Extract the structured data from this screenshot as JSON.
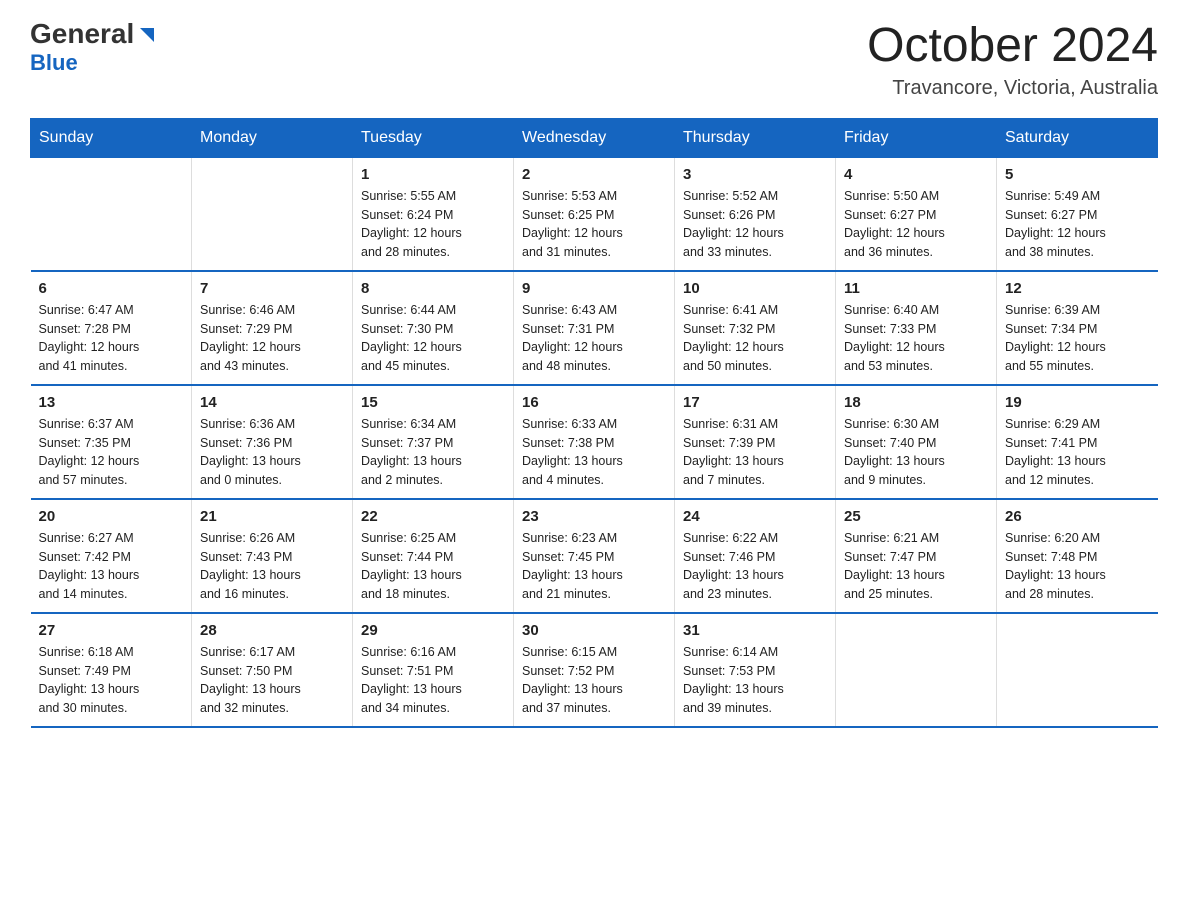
{
  "header": {
    "logo": {
      "general": "General",
      "blue": "Blue"
    },
    "title": "October 2024",
    "location": "Travancore, Victoria, Australia"
  },
  "weekdays": [
    "Sunday",
    "Monday",
    "Tuesday",
    "Wednesday",
    "Thursday",
    "Friday",
    "Saturday"
  ],
  "weeks": [
    [
      {
        "day": "",
        "info": ""
      },
      {
        "day": "",
        "info": ""
      },
      {
        "day": "1",
        "info": "Sunrise: 5:55 AM\nSunset: 6:24 PM\nDaylight: 12 hours\nand 28 minutes."
      },
      {
        "day": "2",
        "info": "Sunrise: 5:53 AM\nSunset: 6:25 PM\nDaylight: 12 hours\nand 31 minutes."
      },
      {
        "day": "3",
        "info": "Sunrise: 5:52 AM\nSunset: 6:26 PM\nDaylight: 12 hours\nand 33 minutes."
      },
      {
        "day": "4",
        "info": "Sunrise: 5:50 AM\nSunset: 6:27 PM\nDaylight: 12 hours\nand 36 minutes."
      },
      {
        "day": "5",
        "info": "Sunrise: 5:49 AM\nSunset: 6:27 PM\nDaylight: 12 hours\nand 38 minutes."
      }
    ],
    [
      {
        "day": "6",
        "info": "Sunrise: 6:47 AM\nSunset: 7:28 PM\nDaylight: 12 hours\nand 41 minutes."
      },
      {
        "day": "7",
        "info": "Sunrise: 6:46 AM\nSunset: 7:29 PM\nDaylight: 12 hours\nand 43 minutes."
      },
      {
        "day": "8",
        "info": "Sunrise: 6:44 AM\nSunset: 7:30 PM\nDaylight: 12 hours\nand 45 minutes."
      },
      {
        "day": "9",
        "info": "Sunrise: 6:43 AM\nSunset: 7:31 PM\nDaylight: 12 hours\nand 48 minutes."
      },
      {
        "day": "10",
        "info": "Sunrise: 6:41 AM\nSunset: 7:32 PM\nDaylight: 12 hours\nand 50 minutes."
      },
      {
        "day": "11",
        "info": "Sunrise: 6:40 AM\nSunset: 7:33 PM\nDaylight: 12 hours\nand 53 minutes."
      },
      {
        "day": "12",
        "info": "Sunrise: 6:39 AM\nSunset: 7:34 PM\nDaylight: 12 hours\nand 55 minutes."
      }
    ],
    [
      {
        "day": "13",
        "info": "Sunrise: 6:37 AM\nSunset: 7:35 PM\nDaylight: 12 hours\nand 57 minutes."
      },
      {
        "day": "14",
        "info": "Sunrise: 6:36 AM\nSunset: 7:36 PM\nDaylight: 13 hours\nand 0 minutes."
      },
      {
        "day": "15",
        "info": "Sunrise: 6:34 AM\nSunset: 7:37 PM\nDaylight: 13 hours\nand 2 minutes."
      },
      {
        "day": "16",
        "info": "Sunrise: 6:33 AM\nSunset: 7:38 PM\nDaylight: 13 hours\nand 4 minutes."
      },
      {
        "day": "17",
        "info": "Sunrise: 6:31 AM\nSunset: 7:39 PM\nDaylight: 13 hours\nand 7 minutes."
      },
      {
        "day": "18",
        "info": "Sunrise: 6:30 AM\nSunset: 7:40 PM\nDaylight: 13 hours\nand 9 minutes."
      },
      {
        "day": "19",
        "info": "Sunrise: 6:29 AM\nSunset: 7:41 PM\nDaylight: 13 hours\nand 12 minutes."
      }
    ],
    [
      {
        "day": "20",
        "info": "Sunrise: 6:27 AM\nSunset: 7:42 PM\nDaylight: 13 hours\nand 14 minutes."
      },
      {
        "day": "21",
        "info": "Sunrise: 6:26 AM\nSunset: 7:43 PM\nDaylight: 13 hours\nand 16 minutes."
      },
      {
        "day": "22",
        "info": "Sunrise: 6:25 AM\nSunset: 7:44 PM\nDaylight: 13 hours\nand 18 minutes."
      },
      {
        "day": "23",
        "info": "Sunrise: 6:23 AM\nSunset: 7:45 PM\nDaylight: 13 hours\nand 21 minutes."
      },
      {
        "day": "24",
        "info": "Sunrise: 6:22 AM\nSunset: 7:46 PM\nDaylight: 13 hours\nand 23 minutes."
      },
      {
        "day": "25",
        "info": "Sunrise: 6:21 AM\nSunset: 7:47 PM\nDaylight: 13 hours\nand 25 minutes."
      },
      {
        "day": "26",
        "info": "Sunrise: 6:20 AM\nSunset: 7:48 PM\nDaylight: 13 hours\nand 28 minutes."
      }
    ],
    [
      {
        "day": "27",
        "info": "Sunrise: 6:18 AM\nSunset: 7:49 PM\nDaylight: 13 hours\nand 30 minutes."
      },
      {
        "day": "28",
        "info": "Sunrise: 6:17 AM\nSunset: 7:50 PM\nDaylight: 13 hours\nand 32 minutes."
      },
      {
        "day": "29",
        "info": "Sunrise: 6:16 AM\nSunset: 7:51 PM\nDaylight: 13 hours\nand 34 minutes."
      },
      {
        "day": "30",
        "info": "Sunrise: 6:15 AM\nSunset: 7:52 PM\nDaylight: 13 hours\nand 37 minutes."
      },
      {
        "day": "31",
        "info": "Sunrise: 6:14 AM\nSunset: 7:53 PM\nDaylight: 13 hours\nand 39 minutes."
      },
      {
        "day": "",
        "info": ""
      },
      {
        "day": "",
        "info": ""
      }
    ]
  ]
}
